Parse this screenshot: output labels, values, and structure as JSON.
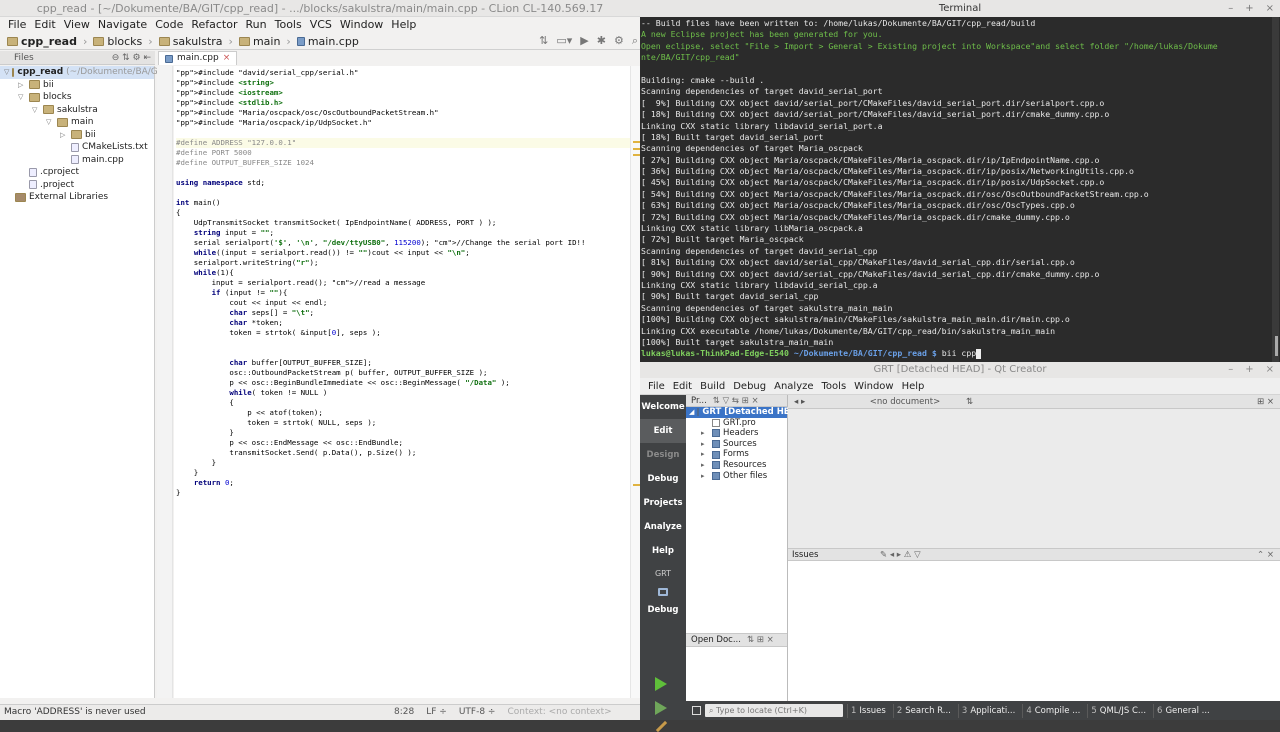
{
  "clion": {
    "title": "cpp_read - [~/Dokumente/BA/GIT/cpp_read] - .../blocks/sakulstra/main/main.cpp - CLion CL-140.569.17",
    "menu": [
      "File",
      "Edit",
      "View",
      "Navigate",
      "Code",
      "Refactor",
      "Run",
      "Tools",
      "VCS",
      "Window",
      "Help"
    ],
    "breadcrumbs": [
      "cpp_read",
      "blocks",
      "sakulstra",
      "main",
      "main.cpp"
    ],
    "project_panel_label": "Files",
    "tree": [
      {
        "label": "cpp_read",
        "extra": "(~/Dokumente/BA/GIT",
        "indent": 0,
        "arrow": "▽",
        "type": "folder",
        "bold": true
      },
      {
        "label": "bii",
        "indent": 1,
        "arrow": "▷",
        "type": "folder"
      },
      {
        "label": "blocks",
        "indent": 1,
        "arrow": "▽",
        "type": "folder"
      },
      {
        "label": "sakulstra",
        "indent": 2,
        "arrow": "▽",
        "type": "folder"
      },
      {
        "label": "main",
        "indent": 3,
        "arrow": "▽",
        "type": "folder"
      },
      {
        "label": "bii",
        "indent": 4,
        "arrow": "▷",
        "type": "folder"
      },
      {
        "label": "CMakeLists.txt",
        "indent": 4,
        "arrow": "",
        "type": "file"
      },
      {
        "label": "main.cpp",
        "indent": 4,
        "arrow": "",
        "type": "file"
      },
      {
        "label": ".cproject",
        "indent": 1,
        "arrow": "",
        "type": "file"
      },
      {
        "label": ".project",
        "indent": 1,
        "arrow": "",
        "type": "file"
      },
      {
        "label": "External Libraries",
        "indent": 0,
        "arrow": "",
        "type": "lib"
      }
    ],
    "editor_tab": "main.cpp",
    "status_message": "Macro 'ADDRESS' is never used",
    "status_pos": "8:28",
    "status_le": "LF ÷",
    "status_enc": "UTF-8 ÷",
    "status_ctx": "Context: <no context>"
  },
  "code_lines": [
    {
      "t": "#include \"david/serial_cpp/serial.h\"",
      "c": "inc"
    },
    {
      "t": "#include <string>",
      "c": "inc"
    },
    {
      "t": "#include <iostream>",
      "c": "inc"
    },
    {
      "t": "#include <stdlib.h>",
      "c": "inc"
    },
    {
      "t": "#include \"Maria/oscpack/osc/OscOutboundPacketStream.h\"",
      "c": "inc"
    },
    {
      "t": "#include \"Maria/oscpack/ip/UdpSocket.h\"",
      "c": "inc"
    },
    {
      "t": "",
      "c": "plain"
    },
    {
      "t": "#define ADDRESS \"127.0.0.1\"",
      "c": "def",
      "hl": true
    },
    {
      "t": "#define PORT 5000",
      "c": "def"
    },
    {
      "t": "#define OUTPUT_BUFFER_SIZE 1024",
      "c": "def"
    },
    {
      "t": "",
      "c": "plain"
    },
    {
      "t": "using namespace std;",
      "c": "plain"
    },
    {
      "t": "",
      "c": "plain"
    },
    {
      "t": "int main()",
      "c": "plain"
    },
    {
      "t": "{",
      "c": "plain"
    },
    {
      "t": "    UdpTransmitSocket transmitSocket( IpEndpointName( ADDRESS, PORT ) );",
      "c": "plain"
    },
    {
      "t": "    string input = \"\";",
      "c": "plain"
    },
    {
      "t": "    serial serialport('$', '\\n', \"/dev/ttyUSB0\", 115200); //Change the serial port ID!!",
      "c": "plain"
    },
    {
      "t": "    while((input = serialport.read()) != \"\")cout << input << \"\\n\";",
      "c": "plain"
    },
    {
      "t": "    serialport.writeString(\"r\");",
      "c": "plain"
    },
    {
      "t": "    while(1){",
      "c": "plain"
    },
    {
      "t": "        input = serialport.read(); //read a message",
      "c": "plain"
    },
    {
      "t": "        if (input != \"\"){",
      "c": "plain"
    },
    {
      "t": "            cout << input << endl;",
      "c": "plain"
    },
    {
      "t": "            char seps[] = \"\\t\";",
      "c": "plain"
    },
    {
      "t": "            char *token;",
      "c": "plain"
    },
    {
      "t": "            token = strtok( &input[0], seps );",
      "c": "plain"
    },
    {
      "t": "",
      "c": "plain"
    },
    {
      "t": "",
      "c": "plain"
    },
    {
      "t": "            char buffer[OUTPUT_BUFFER_SIZE];",
      "c": "plain"
    },
    {
      "t": "            osc::OutboundPacketStream p( buffer, OUTPUT_BUFFER_SIZE );",
      "c": "plain"
    },
    {
      "t": "            p << osc::BeginBundleImmediate << osc::BeginMessage( \"/Data\" );",
      "c": "plain"
    },
    {
      "t": "            while( token != NULL )",
      "c": "plain"
    },
    {
      "t": "            {",
      "c": "plain"
    },
    {
      "t": "                p << atof(token);",
      "c": "plain"
    },
    {
      "t": "                token = strtok( NULL, seps );",
      "c": "plain"
    },
    {
      "t": "            }",
      "c": "plain"
    },
    {
      "t": "            p << osc::EndMessage << osc::EndBundle;",
      "c": "plain"
    },
    {
      "t": "            transmitSocket.Send( p.Data(), p.Size() );",
      "c": "plain"
    },
    {
      "t": "        }",
      "c": "plain"
    },
    {
      "t": "    }",
      "c": "plain"
    },
    {
      "t": "    return 0;",
      "c": "plain"
    },
    {
      "t": "}",
      "c": "plain"
    }
  ],
  "terminal": {
    "title": "Terminal",
    "lines": [
      {
        "t": "-- Build files have been written to: /home/lukas/Dokumente/BA/GIT/cpp_read/build",
        "c": ""
      },
      {
        "t": "A new Eclipse project has been generated for you.",
        "c": "tg"
      },
      {
        "t": "Open eclipse, select \"File > Import > General > Existing project into Workspace\"and select folder \"/home/lukas/Dokume",
        "c": "tg"
      },
      {
        "t": "nte/BA/GIT/cpp_read\"",
        "c": "tg"
      },
      {
        "t": "",
        "c": ""
      },
      {
        "t": "Building: cmake --build .",
        "c": ""
      },
      {
        "t": "Scanning dependencies of target david_serial_port",
        "c": ""
      },
      {
        "t": "[  9%] Building CXX object david/serial_port/CMakeFiles/david_serial_port.dir/serialport.cpp.o",
        "c": ""
      },
      {
        "t": "[ 18%] Building CXX object david/serial_port/CMakeFiles/david_serial_port.dir/cmake_dummy.cpp.o",
        "c": ""
      },
      {
        "t": "Linking CXX static library libdavid_serial_port.a",
        "c": ""
      },
      {
        "t": "[ 18%] Built target david_serial_port",
        "c": ""
      },
      {
        "t": "Scanning dependencies of target Maria_oscpack",
        "c": ""
      },
      {
        "t": "[ 27%] Building CXX object Maria/oscpack/CMakeFiles/Maria_oscpack.dir/ip/IpEndpointName.cpp.o",
        "c": ""
      },
      {
        "t": "[ 36%] Building CXX object Maria/oscpack/CMakeFiles/Maria_oscpack.dir/ip/posix/NetworkingUtils.cpp.o",
        "c": ""
      },
      {
        "t": "[ 45%] Building CXX object Maria/oscpack/CMakeFiles/Maria_oscpack.dir/ip/posix/UdpSocket.cpp.o",
        "c": ""
      },
      {
        "t": "[ 54%] Building CXX object Maria/oscpack/CMakeFiles/Maria_oscpack.dir/osc/OscOutboundPacketStream.cpp.o",
        "c": ""
      },
      {
        "t": "[ 63%] Building CXX object Maria/oscpack/CMakeFiles/Maria_oscpack.dir/osc/OscTypes.cpp.o",
        "c": ""
      },
      {
        "t": "[ 72%] Building CXX object Maria/oscpack/CMakeFiles/Maria_oscpack.dir/cmake_dummy.cpp.o",
        "c": ""
      },
      {
        "t": "Linking CXX static library libMaria_oscpack.a",
        "c": ""
      },
      {
        "t": "[ 72%] Built target Maria_oscpack",
        "c": ""
      },
      {
        "t": "Scanning dependencies of target david_serial_cpp",
        "c": ""
      },
      {
        "t": "[ 81%] Building CXX object david/serial_cpp/CMakeFiles/david_serial_cpp.dir/serial.cpp.o",
        "c": ""
      },
      {
        "t": "[ 90%] Building CXX object david/serial_cpp/CMakeFiles/david_serial_cpp.dir/cmake_dummy.cpp.o",
        "c": ""
      },
      {
        "t": "Linking CXX static library libdavid_serial_cpp.a",
        "c": ""
      },
      {
        "t": "[ 90%] Built target david_serial_cpp",
        "c": ""
      },
      {
        "t": "Scanning dependencies of target sakulstra_main_main",
        "c": ""
      },
      {
        "t": "[100%] Building CXX object sakulstra/main/CMakeFiles/sakulstra_main_main.dir/main.cpp.o",
        "c": ""
      },
      {
        "t": "Linking CXX executable /home/lukas/Dokumente/BA/GIT/cpp_read/bin/sakulstra_main_main",
        "c": ""
      },
      {
        "t": "[100%] Built target sakulstra_main_main",
        "c": ""
      }
    ],
    "prompt_user": "lukas@lukas-ThinkPad-Edge-E540",
    "prompt_path": "~/Dokumente/BA/GIT/cpp_read $",
    "prompt_cmd": " bii cpp"
  },
  "qt": {
    "title": "GRT [Detached HEAD] - Qt Creator",
    "menu": [
      "File",
      "Edit",
      "Build",
      "Debug",
      "Analyze",
      "Tools",
      "Window",
      "Help"
    ],
    "modes": [
      {
        "label": "Welcome",
        "state": "normal"
      },
      {
        "label": "Edit",
        "state": "active"
      },
      {
        "label": "Design",
        "state": "dis"
      },
      {
        "label": "Debug",
        "state": "normal"
      },
      {
        "label": "Projects",
        "state": "normal"
      },
      {
        "label": "Analyze",
        "state": "normal"
      },
      {
        "label": "Help",
        "state": "normal"
      }
    ],
    "kit_label": "GRT",
    "kit_mode": "Debug",
    "projects_label": "Pr...",
    "tree": [
      {
        "label": "GRT [Detached HE",
        "indent": 0,
        "arrow": "◢",
        "sel": true
      },
      {
        "label": "GRT.pro",
        "indent": 1,
        "arrow": ""
      },
      {
        "label": "Headers",
        "indent": 1,
        "arrow": "▸"
      },
      {
        "label": "Sources",
        "indent": 1,
        "arrow": "▸"
      },
      {
        "label": "Forms",
        "indent": 1,
        "arrow": "▸"
      },
      {
        "label": "Resources",
        "indent": 1,
        "arrow": "▸"
      },
      {
        "label": "Other files",
        "indent": 1,
        "arrow": "▸"
      }
    ],
    "open_docs_label": "Open Doc...",
    "no_document": "<no document>",
    "issues_label": "Issues",
    "locate_placeholder": "Type to locate (Ctrl+K)",
    "status_tabs": [
      {
        "num": "1",
        "label": "Issues"
      },
      {
        "num": "2",
        "label": "Search R..."
      },
      {
        "num": "3",
        "label": "Applicati..."
      },
      {
        "num": "4",
        "label": "Compile ..."
      },
      {
        "num": "5",
        "label": "QML/JS C..."
      },
      {
        "num": "6",
        "label": "General ..."
      }
    ]
  }
}
